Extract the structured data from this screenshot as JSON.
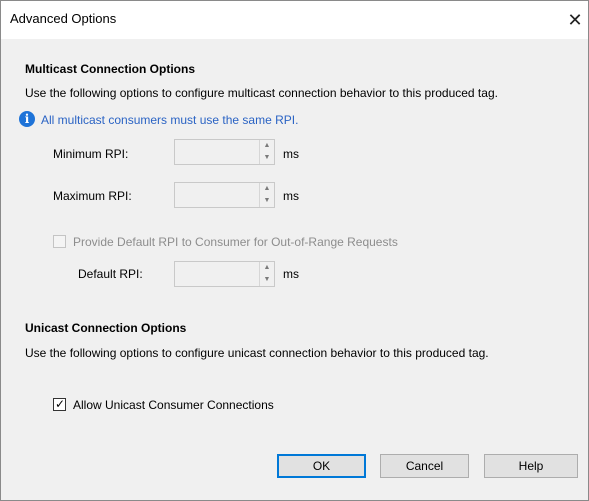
{
  "window": {
    "title": "Advanced Options",
    "close_glyph": "✕"
  },
  "multicast": {
    "title": "Multicast Connection Options",
    "description": "Use the following options to configure multicast connection behavior to this produced tag.",
    "info_text": "All multicast consumers must use the same RPI.",
    "info_icon": "info-icon",
    "min_rpi_label": "Minimum RPI:",
    "min_rpi_value": "",
    "min_rpi_unit": "ms",
    "max_rpi_label": "Maximum RPI:",
    "max_rpi_value": "",
    "max_rpi_unit": "ms",
    "default_checkbox_label": "Provide Default RPI to Consumer for Out-of-Range Requests",
    "default_checkbox_checked": false,
    "default_rpi_label": "Default RPI:",
    "default_rpi_value": "",
    "default_rpi_unit": "ms"
  },
  "unicast": {
    "title": "Unicast Connection Options",
    "description": "Use the following options to configure unicast connection behavior to this produced tag.",
    "allow_checkbox_label": "Allow Unicast Consumer Connections",
    "allow_checkbox_checked": true
  },
  "buttons": {
    "ok": "OK",
    "cancel": "Cancel",
    "help": "Help"
  },
  "colors": {
    "info_icon": "#1e73d8",
    "info_text": "#2a63c4",
    "default_button_border": "#0078d7",
    "content_background": "#f0f0f0"
  }
}
